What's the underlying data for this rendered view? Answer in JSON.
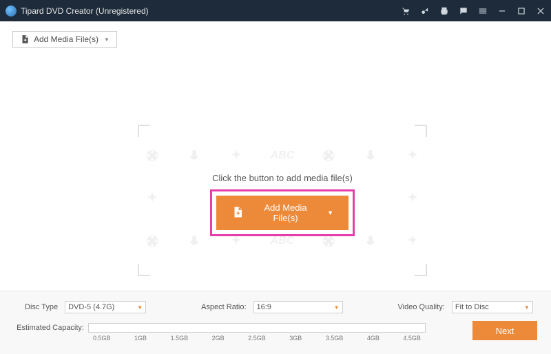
{
  "titlebar": {
    "title": "Tipard DVD Creator (Unregistered)"
  },
  "toolbar": {
    "add_media_label": "Add Media File(s)"
  },
  "dropzone": {
    "prompt": "Click the button to add media file(s)",
    "big_button_label": "Add Media File(s)",
    "ghost_abc": "ABC"
  },
  "options": {
    "disc_type_label": "Disc Type",
    "disc_type_value": "DVD-5 (4.7G)",
    "aspect_ratio_label": "Aspect Ratio:",
    "aspect_ratio_value": "16:9",
    "video_quality_label": "Video Quality:",
    "video_quality_value": "Fit to Disc"
  },
  "capacity": {
    "label": "Estimated Capacity:",
    "ticks": [
      "0.5GB",
      "1GB",
      "1.5GB",
      "2GB",
      "2.5GB",
      "3GB",
      "3.5GB",
      "4GB",
      "4.5GB"
    ]
  },
  "next_label": "Next",
  "colors": {
    "accent": "#ec8a3a",
    "highlight": "#e73da9",
    "titlebar": "#1d2b3a"
  }
}
